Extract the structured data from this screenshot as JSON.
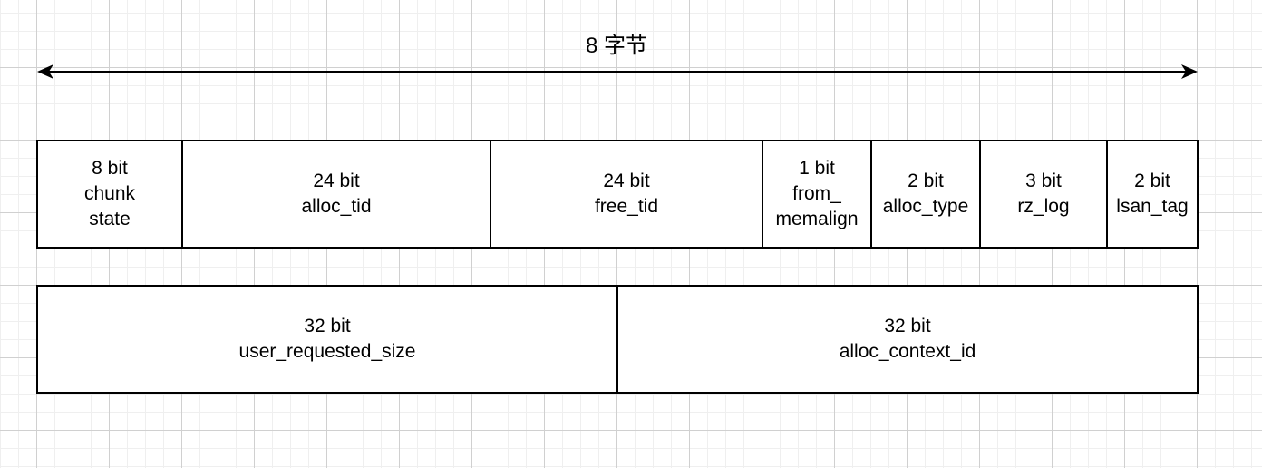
{
  "title": "8 字节",
  "row1": [
    {
      "bits": "8 bit",
      "lines": [
        "chunk",
        "state"
      ]
    },
    {
      "bits": "24 bit",
      "lines": [
        "alloc_tid"
      ]
    },
    {
      "bits": "24 bit",
      "lines": [
        "free_tid"
      ]
    },
    {
      "bits": "1 bit",
      "lines": [
        "from_",
        "memalign"
      ]
    },
    {
      "bits": "2 bit",
      "lines": [
        "alloc_type"
      ]
    },
    {
      "bits": "3 bit",
      "lines": [
        "rz_log"
      ]
    },
    {
      "bits": "2 bit",
      "lines": [
        "lsan_tag"
      ]
    }
  ],
  "row2": [
    {
      "bits": "32 bit",
      "lines": [
        "user_requested_size"
      ]
    },
    {
      "bits": "32 bit",
      "lines": [
        "alloc_context_id"
      ]
    }
  ]
}
